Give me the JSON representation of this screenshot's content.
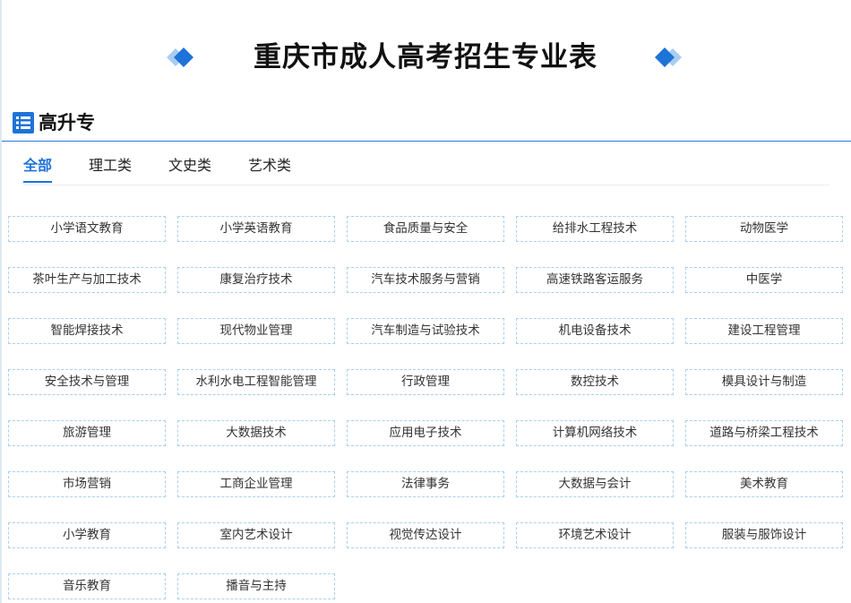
{
  "page": {
    "title": "重庆市成人高考招生专业表"
  },
  "section": {
    "title": "高升专",
    "icon": "list-icon"
  },
  "tabs": [
    {
      "label": "全部",
      "active": true
    },
    {
      "label": "理工类",
      "active": false
    },
    {
      "label": "文史类",
      "active": false
    },
    {
      "label": "艺术类",
      "active": false
    }
  ],
  "majors": [
    "小学语文教育",
    "小学英语教育",
    "食品质量与安全",
    "给排水工程技术",
    "动物医学",
    "茶叶生产与加工技术",
    "康复治疗技术",
    "汽车技术服务与营销",
    "高速铁路客运服务",
    "中医学",
    "智能焊接技术",
    "现代物业管理",
    "汽车制造与试验技术",
    "机电设备技术",
    "建设工程管理",
    "安全技术与管理",
    "水利水电工程智能管理",
    "行政管理",
    "数控技术",
    "模具设计与制造",
    "旅游管理",
    "大数据技术",
    "应用电子技术",
    "计算机网络技术",
    "道路与桥梁工程技术",
    "市场营销",
    "工商企业管理",
    "法律事务",
    "大数据与会计",
    "美术教育",
    "小学教育",
    "室内艺术设计",
    "视觉传达设计",
    "环境艺术设计",
    "服装与服饰设计",
    "音乐教育",
    "播音与主持"
  ],
  "colors": {
    "accent": "#1e73d8",
    "cell_border": "#a9d0ee",
    "diamond_dark": "#1e73d8",
    "diamond_light": "#a9cdf2"
  }
}
